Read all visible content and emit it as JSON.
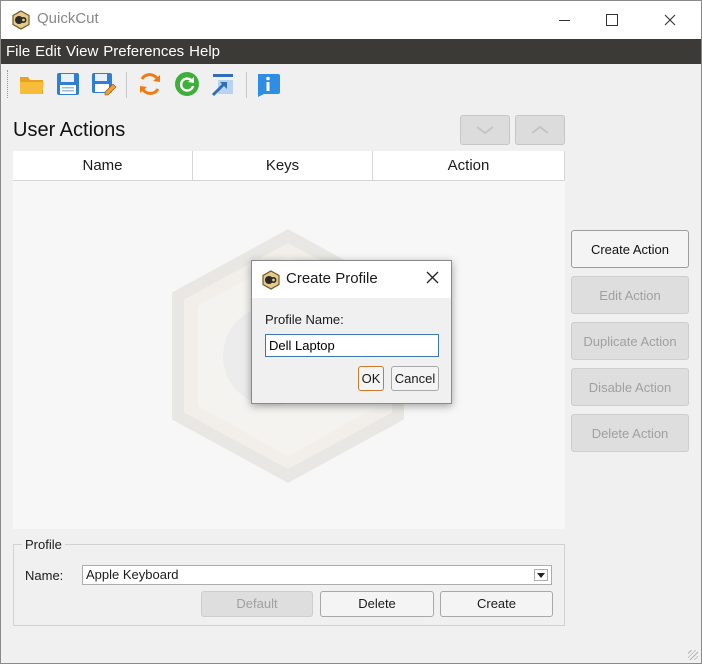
{
  "window": {
    "title": "QuickCut"
  },
  "menu": [
    "File",
    "Edit",
    "View",
    "Preferences",
    "Help"
  ],
  "toolbar": {
    "icons": [
      "open-folder-icon",
      "save-icon",
      "save-as-icon",
      "reload-icon",
      "refresh-icon",
      "export-icon",
      "info-icon"
    ]
  },
  "user_actions": {
    "title": "User Actions",
    "columns": [
      "Name",
      "Keys",
      "Action"
    ],
    "rows": []
  },
  "side_buttons": {
    "create_action": "Create Action",
    "edit_action": "Edit Action",
    "duplicate_action": "Duplicate Action",
    "disable_action": "Disable Action",
    "delete_action": "Delete Action"
  },
  "profile": {
    "group_title": "Profile",
    "name_label": "Name:",
    "selected": "Apple Keyboard",
    "default_button": "Default",
    "delete_button": "Delete",
    "create_button": "Create"
  },
  "dialog": {
    "title": "Create Profile",
    "label": "Profile Name:",
    "value": "Dell Laptop",
    "ok": "OK",
    "cancel": "Cancel"
  },
  "colors": {
    "menubar": "#3c3a36",
    "accent_focus": "#3c78b5",
    "ok_border": "#d07a2c"
  }
}
